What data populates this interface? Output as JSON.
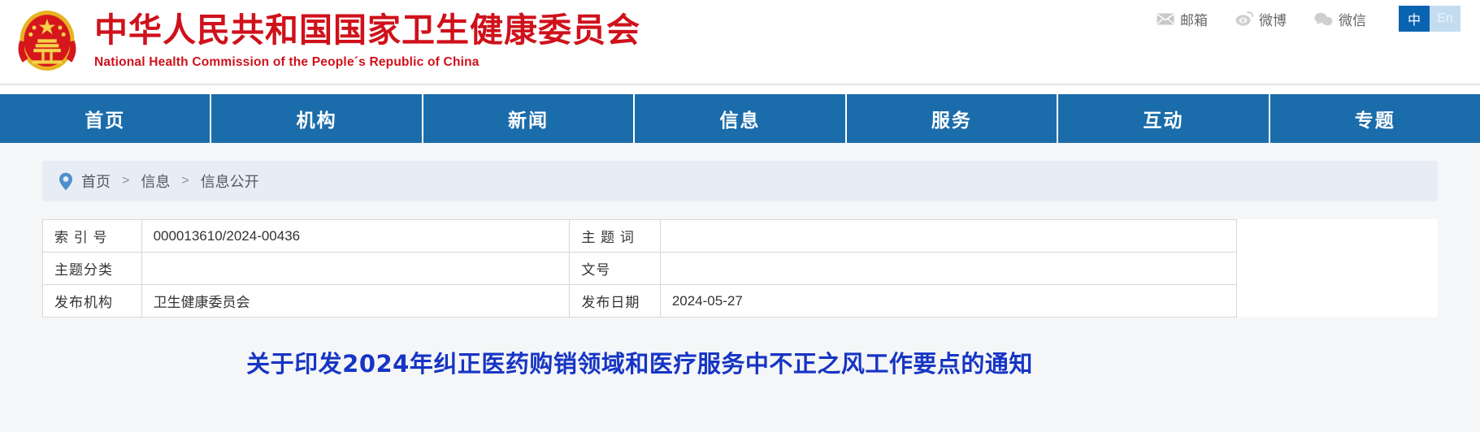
{
  "header": {
    "emblem_icon": "national-emblem-icon",
    "org_name_cn": "中华人民共和国国家卫生健康委员会",
    "org_name_en": "National Health Commission of the People´s Republic of China",
    "brand_color": "#cf111b"
  },
  "top_utility": {
    "links": [
      {
        "label": "邮箱",
        "icon": "mail-icon"
      },
      {
        "label": "微博",
        "icon": "weibo-icon"
      },
      {
        "label": "微信",
        "icon": "wechat-icon"
      }
    ],
    "language": {
      "active": "中",
      "inactive": "En",
      "active_color": "#0a63b0",
      "inactive_color": "#c3dcf0"
    }
  },
  "nav": {
    "accent_color": "#1b6cab",
    "items": [
      {
        "label": "首页"
      },
      {
        "label": "机构"
      },
      {
        "label": "新闻"
      },
      {
        "label": "信息"
      },
      {
        "label": "服务"
      },
      {
        "label": "互动"
      },
      {
        "label": "专题"
      }
    ]
  },
  "breadcrumb": {
    "icon": "location-pin-icon",
    "separator": ">",
    "items": [
      {
        "label": "首页"
      },
      {
        "label": "信息"
      },
      {
        "label": "信息公开"
      }
    ]
  },
  "meta_table": {
    "rows": [
      {
        "label_left": "索 引 号",
        "value_left": "000013610/2024-00436",
        "label_right": "主 题 词",
        "value_right": ""
      },
      {
        "label_left": "主题分类",
        "value_left": "",
        "label_right": "文号",
        "value_right": ""
      },
      {
        "label_left": "发布机构",
        "value_left": "卫生健康委员会",
        "label_right": "发布日期",
        "value_right": "2024-05-27"
      }
    ]
  },
  "document": {
    "title": "关于印发2024年纠正医药购销领域和医疗服务中不正之风工作要点的通知",
    "title_color": "#1635c4"
  }
}
